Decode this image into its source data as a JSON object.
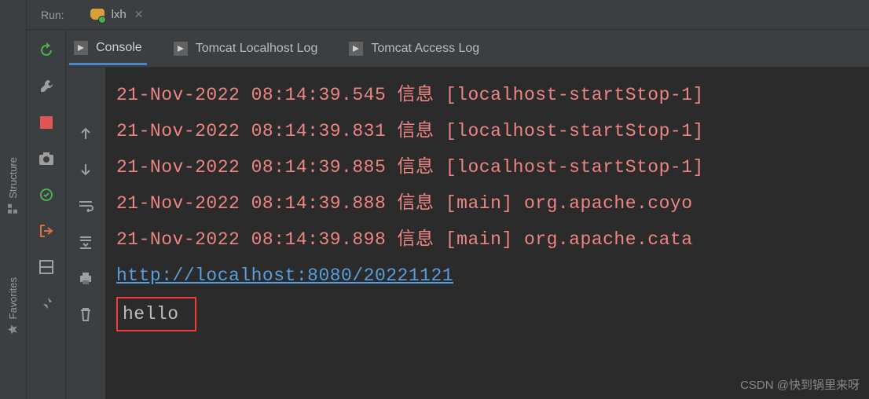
{
  "sidebar": {
    "structure_label": "Structure",
    "favorites_label": "Favorites"
  },
  "topbar": {
    "run_label": "Run:",
    "config_name": "lxh"
  },
  "tabs": [
    {
      "label": "Console",
      "active": true
    },
    {
      "label": "Tomcat Localhost Log",
      "active": false
    },
    {
      "label": "Tomcat Access Log",
      "active": false
    }
  ],
  "log_lines": [
    {
      "type": "info",
      "text": "21-Nov-2022 08:14:39.545 信息 [localhost-startStop-1]"
    },
    {
      "type": "info",
      "text": "21-Nov-2022 08:14:39.831 信息 [localhost-startStop-1]"
    },
    {
      "type": "info",
      "text": "21-Nov-2022 08:14:39.885 信息 [localhost-startStop-1]"
    },
    {
      "type": "info",
      "text": "21-Nov-2022 08:14:39.888 信息 [main] org.apache.coyo"
    },
    {
      "type": "info",
      "text": "21-Nov-2022 08:14:39.898 信息 [main] org.apache.cata"
    },
    {
      "type": "link",
      "text": "http://localhost:8080/20221121"
    },
    {
      "type": "plain",
      "text": "hello"
    }
  ],
  "watermark": "CSDN @快到锅里来呀"
}
